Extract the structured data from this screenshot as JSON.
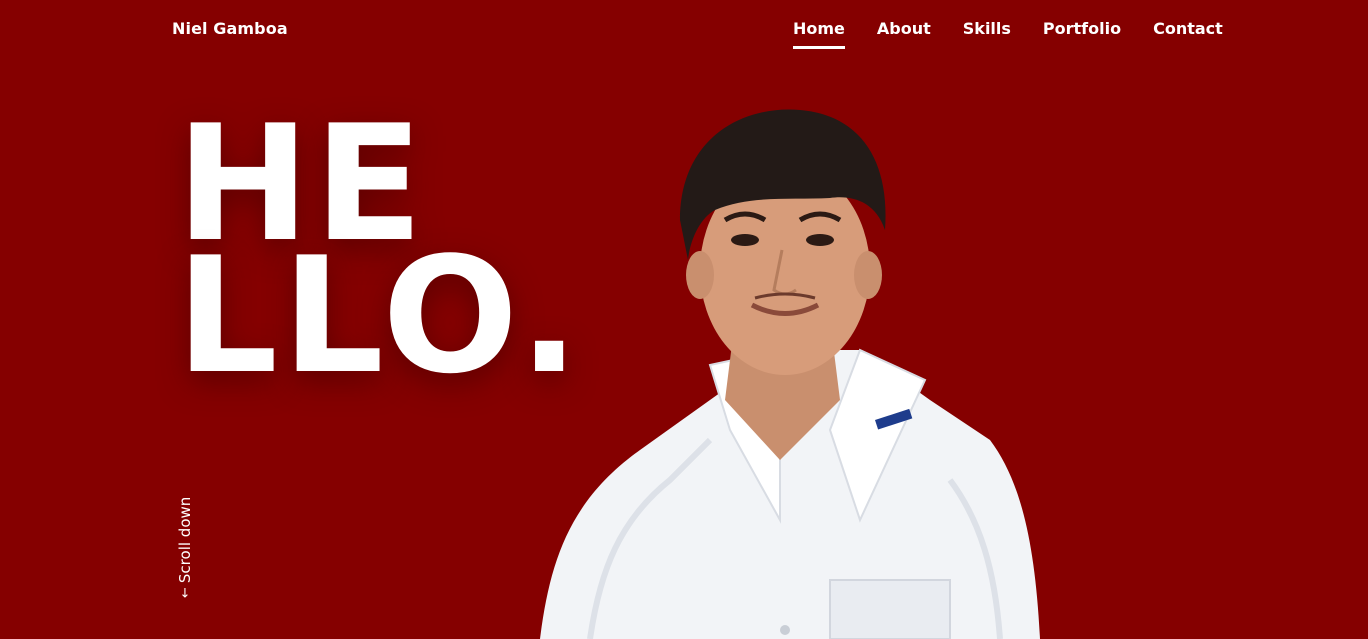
{
  "header": {
    "brand": "Niel Gamboa",
    "nav": [
      {
        "label": "Home",
        "active": true
      },
      {
        "label": "About",
        "active": false
      },
      {
        "label": "Skills",
        "active": false
      },
      {
        "label": "Portfolio",
        "active": false
      },
      {
        "label": "Contact",
        "active": false
      }
    ]
  },
  "hero": {
    "line1": "HE",
    "line2": "LLO.",
    "scroll_label": "Scroll down",
    "scroll_icon": "arrow-down-icon"
  },
  "colors": {
    "background": "#850000",
    "text": "#ffffff"
  }
}
